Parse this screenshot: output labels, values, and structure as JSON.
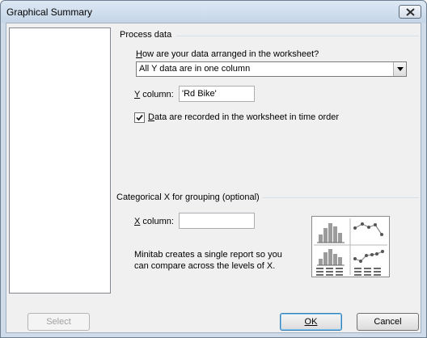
{
  "window": {
    "title": "Graphical Summary",
    "close_icon": "close-icon"
  },
  "process_data": {
    "group_label": "Process data",
    "arrangement_question": "How are your data arranged in the worksheet?",
    "arrangement_value": "All Y data are in one column",
    "y_column_label": "Y column:",
    "y_column_value": "'Rd Bike'",
    "time_order_label": "Data are recorded in the worksheet in time order",
    "time_order_checked": true
  },
  "categorical": {
    "group_label": "Categorical X for grouping (optional)",
    "x_column_label": "X column:",
    "x_column_value": "",
    "note_line1": "Minitab creates a single report so you",
    "note_line2": "can compare across the levels of X."
  },
  "buttons": {
    "select": "Select",
    "ok": "OK",
    "cancel": "Cancel"
  },
  "icons": {
    "dropdown": "chevron-down-icon",
    "check": "check-icon",
    "preview": "report-preview-icon"
  }
}
